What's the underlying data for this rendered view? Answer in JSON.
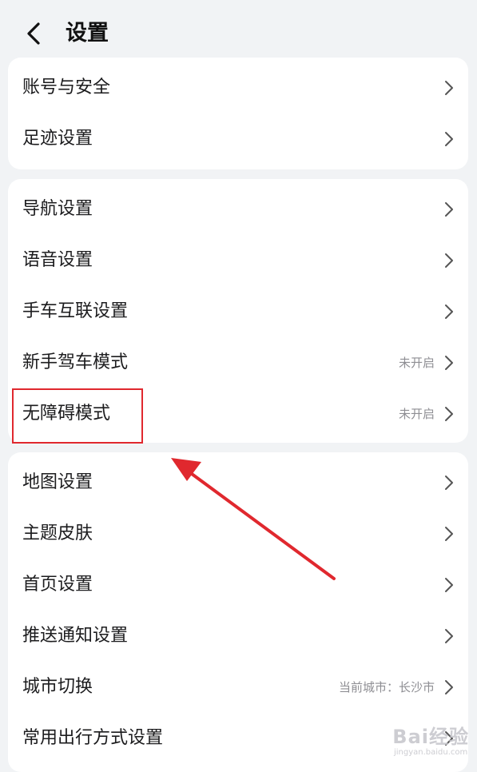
{
  "header": {
    "title": "设置",
    "back_icon": "chevron-left-icon"
  },
  "groups": [
    {
      "items": [
        {
          "label": "账号与安全",
          "value": ""
        },
        {
          "label": "足迹设置",
          "value": ""
        }
      ]
    },
    {
      "items": [
        {
          "label": "导航设置",
          "value": ""
        },
        {
          "label": "语音设置",
          "value": ""
        },
        {
          "label": "手车互联设置",
          "value": ""
        },
        {
          "label": "新手驾车模式",
          "value": "未开启"
        },
        {
          "label": "无障碍模式",
          "value": "未开启"
        }
      ]
    },
    {
      "items": [
        {
          "label": "地图设置",
          "value": ""
        },
        {
          "label": "主题皮肤",
          "value": ""
        },
        {
          "label": "首页设置",
          "value": ""
        },
        {
          "label": "推送通知设置",
          "value": ""
        },
        {
          "label": "城市切换",
          "value": "当前城市：长沙市"
        },
        {
          "label": "常用出行方式设置",
          "value": ""
        }
      ]
    }
  ],
  "watermark": {
    "main": "Bai经验",
    "sub": "jingyan.baidu.com"
  },
  "colors": {
    "background": "#f1f3f5",
    "card": "#ffffff",
    "annotation": "#e0282e",
    "secondary_text": "#8e8e93"
  }
}
